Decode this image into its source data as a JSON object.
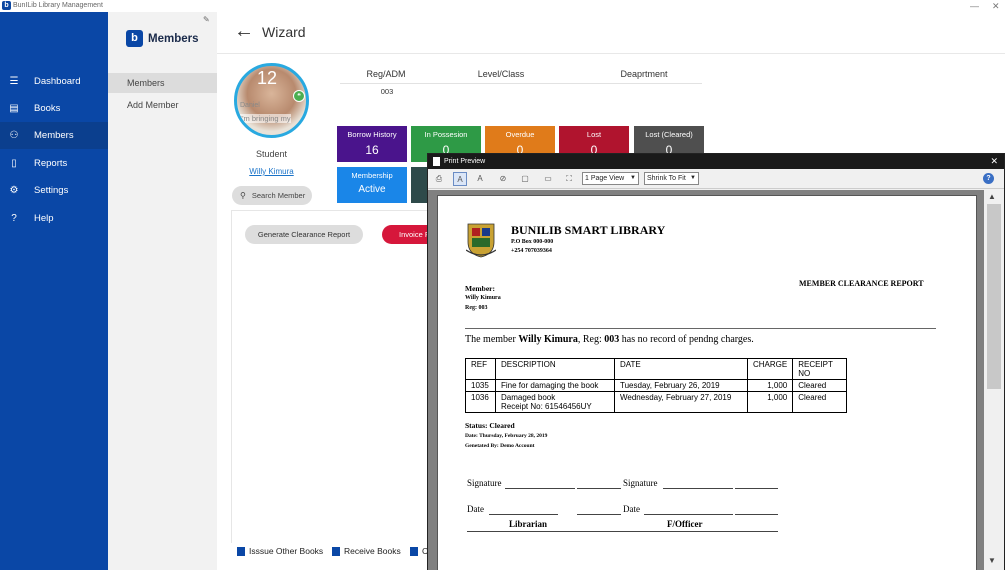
{
  "window": {
    "title": "BunILib Library Management",
    "minimize": "—",
    "close": "✕"
  },
  "nav": {
    "items": [
      {
        "label": "Dashboard",
        "icon": "menu-icon"
      },
      {
        "label": "Books",
        "icon": "book-icon"
      },
      {
        "label": "Members",
        "icon": "members-icon"
      },
      {
        "label": "Reports",
        "icon": "report-icon"
      },
      {
        "label": "Settings",
        "icon": "gear-icon"
      },
      {
        "label": "Help",
        "icon": "help-icon"
      }
    ]
  },
  "subpanel": {
    "title": "Members",
    "pin": "📌",
    "items": [
      {
        "label": "Members"
      },
      {
        "label": "Add Member"
      }
    ]
  },
  "header": {
    "back": "←",
    "title": "Wizard"
  },
  "profile": {
    "avatar_number": "12",
    "avatar_caption1": "Daniel",
    "avatar_caption2": "I'm bringing my",
    "role": "Student",
    "name": "Willy Kimura",
    "search_label": "Search Member"
  },
  "info": {
    "reg_label": "Reg/ADM",
    "level_label": "Level/Class",
    "dept_label": "Deaprtment",
    "reg_value": "003"
  },
  "stats": {
    "borrow_history": {
      "label": "Borrow History",
      "value": "16",
      "color": "#4a148c"
    },
    "in_possession": {
      "label": "In Possesion",
      "value": "0",
      "color": "#2e9a46"
    },
    "overdue": {
      "label": "Overdue",
      "value": "0",
      "color": "#e07b1a"
    },
    "lost": {
      "label": "Lost",
      "value": "0",
      "color": "#b0142e"
    },
    "lost_cleared": {
      "label": "Lost (Cleared)",
      "value": "0",
      "color": "#4f4f4f"
    },
    "membership": {
      "label": "Membership",
      "value": "Active",
      "color": "#1a86e8"
    }
  },
  "actions": {
    "generate_clearance": "Generate Clearance Report",
    "invoice": "Invoice F"
  },
  "bottom_bar": {
    "issue_other": "Isssue Other Books",
    "receive": "Receive Books",
    "third": "C"
  },
  "print_preview": {
    "title": "Print Preview",
    "close": "✕",
    "page_view": "1 Page View",
    "fit": "Shrink To Fit",
    "help": "?",
    "report": {
      "library_name": "BUNILIB SMART LIBRARY",
      "po_box": "P.O Box 000-000",
      "phone": "+254 707039364",
      "heading": "MEMBER CLEARANCE REPORT",
      "member_label": "Member:",
      "member_name": "Willy Kimura",
      "member_reg": "Reg: 003",
      "statement_pre": "The member ",
      "statement_name": "Willy Kimura",
      "statement_mid": ", Reg: ",
      "statement_reg": "003",
      "statement_post": " has no record of pendng charges.",
      "table": {
        "headers": [
          "REF",
          "DESCRIPTION",
          "DATE",
          "CHARGE",
          "RECEIPT NO"
        ],
        "rows": [
          {
            "ref": "1035",
            "desc": "Fine for damaging the book",
            "desc2": "",
            "date": "Tuesday, February 26, 2019",
            "charge": "1,000",
            "receipt": "Cleared"
          },
          {
            "ref": "1036",
            "desc": "Damaged book",
            "desc2": "Receipt No: 61546456UY",
            "date": "Wednesday, February 27, 2019",
            "charge": "1,000",
            "receipt": "Cleared"
          }
        ]
      },
      "status": "Status: Cleared",
      "date_line": "Date: Thursday, February 28, 2019",
      "generated_by": "Genetated By: Demo Account",
      "signature_left": "Signature",
      "signature_right": "Signature",
      "date_left": "Date",
      "date_right": "Date",
      "role_left": "Librarian",
      "role_right": "F/Officer"
    }
  }
}
